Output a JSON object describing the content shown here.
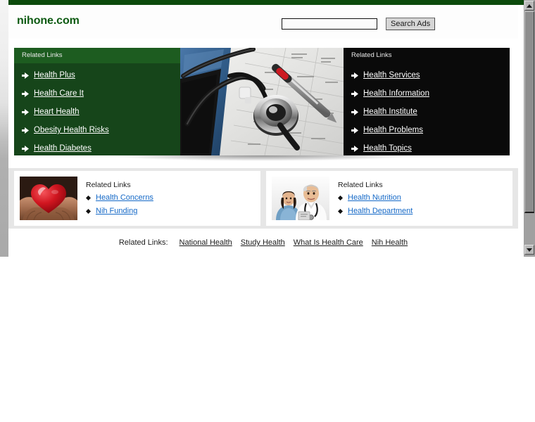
{
  "site": {
    "brand": "nihone.com",
    "top_rule_color": "#0c4a0c",
    "brand_color": "#0d5a12"
  },
  "search": {
    "value": "",
    "placeholder": "",
    "button_label": "Search Ads"
  },
  "banner": {
    "left_panel": {
      "title": "Related Links",
      "background_color": "#16451a",
      "link_color": "#ffffff",
      "links": [
        {
          "label": "Health Plus"
        },
        {
          "label": "Health Care It"
        },
        {
          "label": "Heart Health"
        },
        {
          "label": "Obesity Health Risks"
        },
        {
          "label": "Health Diabetes"
        }
      ]
    },
    "center_image": {
      "alt": "Stethoscope and pen resting on medical forms"
    },
    "right_panel": {
      "title": "Related Links",
      "background_color": "#0a0a0a",
      "link_color": "#ffffff",
      "links": [
        {
          "label": "Health Services"
        },
        {
          "label": "Health Information"
        },
        {
          "label": "Health Institute"
        },
        {
          "label": "Health Problems"
        },
        {
          "label": "Health Topics"
        }
      ]
    }
  },
  "cards": [
    {
      "title": "Related Links",
      "image_alt": "Hands holding a red heart",
      "link_color": "#1569C7",
      "links": [
        {
          "label": "Health Concerns"
        },
        {
          "label": "Nih Funding"
        }
      ]
    },
    {
      "title": "Related Links",
      "image_alt": "Two doctors in scrubs with stethoscope",
      "link_color": "#1569C7",
      "links": [
        {
          "label": "Health Nutrition"
        },
        {
          "label": "Health Department"
        }
      ]
    }
  ],
  "footer": {
    "label": "Related Links:",
    "links": [
      {
        "label": "National Health"
      },
      {
        "label": "Study Health"
      },
      {
        "label": "What Is Health Care"
      },
      {
        "label": "Nih Health"
      }
    ]
  },
  "scrollbar": {
    "up_icon": "triangle-up-icon",
    "down_icon": "triangle-down-icon"
  }
}
